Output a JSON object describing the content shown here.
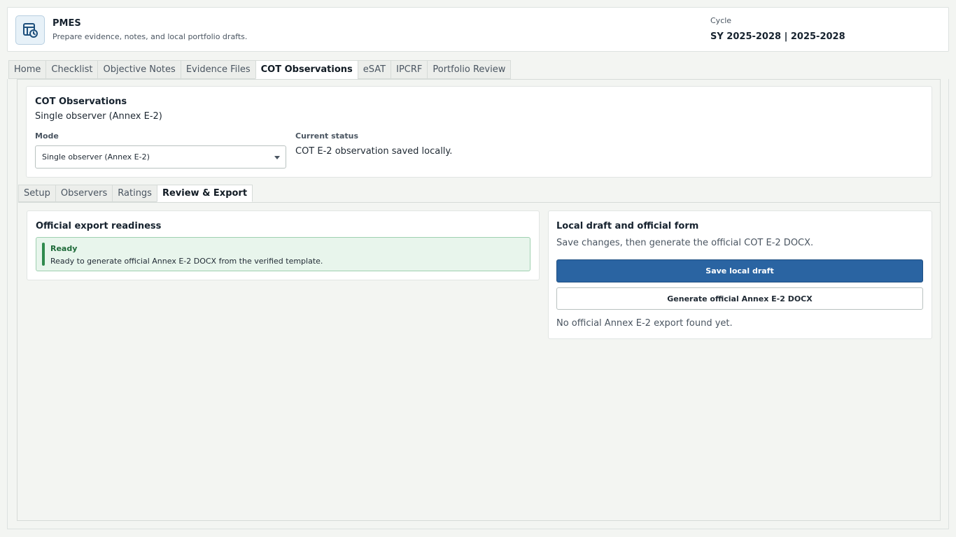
{
  "app": {
    "name": "PMES",
    "subtitle": "Prepare evidence, notes, and local portfolio drafts.",
    "cycle_label": "Cycle",
    "cycle_value": "SY 2025-2028 | 2025-2028"
  },
  "tabs": [
    {
      "label": "Home"
    },
    {
      "label": "Checklist"
    },
    {
      "label": "Objective Notes"
    },
    {
      "label": "Evidence Files"
    },
    {
      "label": "COT Observations"
    },
    {
      "label": "eSAT"
    },
    {
      "label": "IPCRF"
    },
    {
      "label": "Portfolio Review"
    }
  ],
  "active_tab": "COT Observations",
  "cot": {
    "title": "COT Observations",
    "subtitle": "Single observer (Annex E-2)",
    "mode_label": "Mode",
    "mode_value": "Single observer (Annex E-2)",
    "status_label": "Current status",
    "status_value": "COT E-2 observation saved locally."
  },
  "subtabs": [
    {
      "label": "Setup"
    },
    {
      "label": "Observers"
    },
    {
      "label": "Ratings"
    },
    {
      "label": "Review & Export"
    }
  ],
  "active_subtab": "Review & Export",
  "readiness": {
    "title": "Official export readiness",
    "status": "Ready",
    "message": "Ready to generate official Annex E-2 DOCX from the verified template."
  },
  "export": {
    "title": "Local draft and official form",
    "subtitle": "Save changes, then generate the official COT E-2 DOCX.",
    "save_label": "Save local draft",
    "generate_label": "Generate official Annex E-2 DOCX",
    "note": "No official Annex E-2 export found yet."
  },
  "colors": {
    "primary": "#2a64a2",
    "success": "#2f8a4e",
    "success_bg": "#e8f5ec",
    "page_bg": "#f3f5f2"
  },
  "icons": {
    "app_logo": "calendar-clock-icon",
    "select_caret": "caret-down-icon"
  }
}
